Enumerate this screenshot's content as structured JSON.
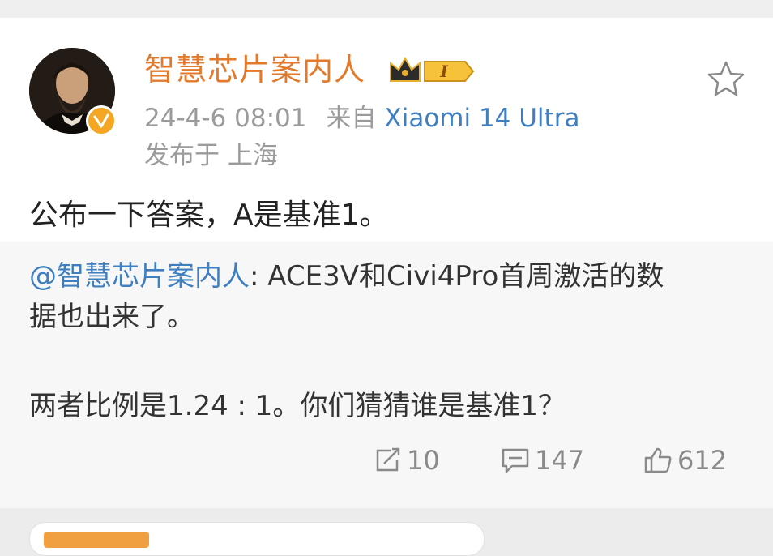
{
  "post": {
    "author": "智慧芯片案内人",
    "level_badge": "I",
    "timestamp": "24-4-6 08:01",
    "source_prefix": "来自",
    "device": "Xiaomi 14 Ultra",
    "location": "发布于 上海",
    "text": "公布一下答案，A是基准1。"
  },
  "repost": {
    "mention": "@智慧芯片案内人",
    "line1_rest": ": ACE3V和Civi4Pro首周激活的数",
    "line2": "据也出来了。",
    "line3": "两者比例是1.24 : 1。你们猜猜谁是基准1？"
  },
  "actions": {
    "repost_count": "10",
    "comment_count": "147",
    "like_count": "612"
  },
  "icons": {
    "verified": "verified-badge-icon",
    "crown": "crown-level-icon",
    "favorite": "star-icon",
    "repost": "repost-icon",
    "comment": "comment-icon",
    "like": "thumbs-up-icon"
  },
  "colors": {
    "username": "#e3792a",
    "link": "#3f7fbf",
    "verified": "#f5a623"
  }
}
